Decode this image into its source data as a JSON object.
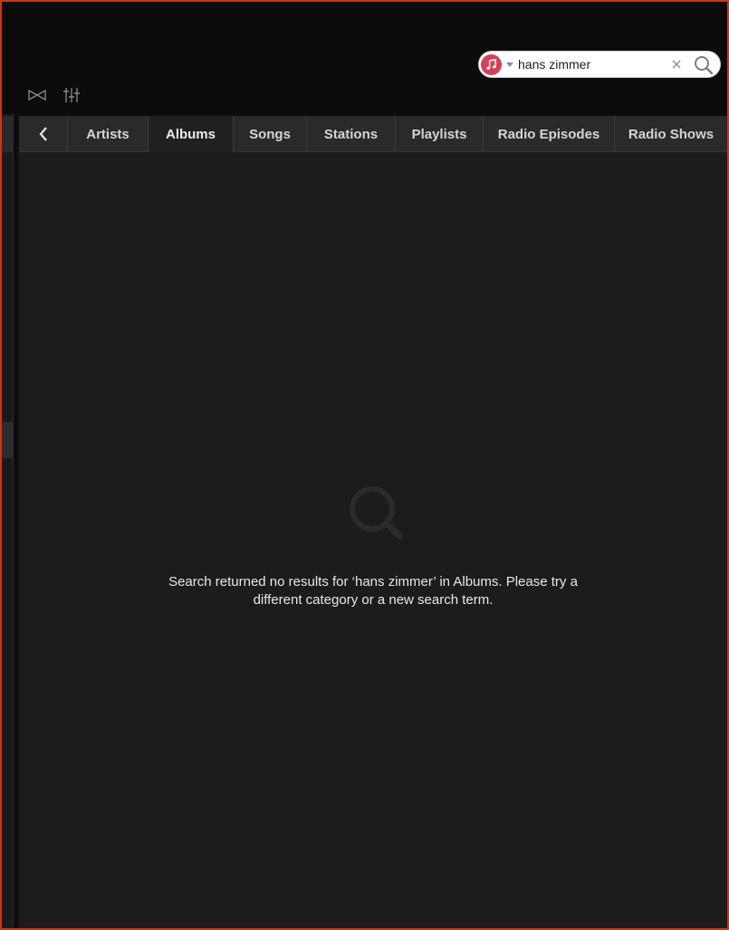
{
  "search": {
    "query": "hans zimmer",
    "source_icon": "music-note-icon",
    "clear_icon": "close-icon",
    "submit_icon": "search-icon"
  },
  "toolbar": {
    "icons": [
      "bowtie-icon",
      "equalizer-icon"
    ]
  },
  "tabs": [
    {
      "label": "Artists",
      "active": false
    },
    {
      "label": "Albums",
      "active": true
    },
    {
      "label": "Songs",
      "active": false
    },
    {
      "label": "Stations",
      "active": false
    },
    {
      "label": "Playlists",
      "active": false
    },
    {
      "label": "Radio Episodes",
      "active": false
    },
    {
      "label": "Radio Shows",
      "active": false
    }
  ],
  "empty_state": {
    "icon": "search-icon",
    "message": "Search returned no results for ‘hans zimmer’ in Albums. Please try a different category or a new search term."
  },
  "colors": {
    "frame": "#c9371b",
    "music_badge": "#d6405a",
    "content_bg": "#1c1c1c",
    "tab_bg": "#2a2a2a"
  }
}
